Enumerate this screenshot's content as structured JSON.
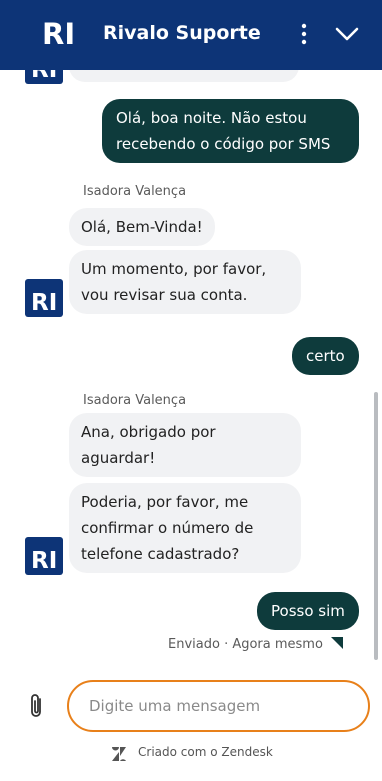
{
  "header": {
    "logo_text": "RI",
    "title": "Rivalo Suporte"
  },
  "messages": {
    "user_1": "Olá, boa noite. Não estou recebendo o código por SMS",
    "sender_1": "Isadora Valença",
    "agent_1": "Olá, Bem-Vinda!",
    "agent_2": "Um momento, por favor, vou revisar sua conta.",
    "user_2": "certo",
    "sender_2": "Isadora Valença",
    "agent_3": "Ana, obrigado por aguardar!",
    "agent_4": "Poderia, por favor, me confirmar o número de telefone cadastrado?",
    "user_3": "Posso sim",
    "status": "Enviado · Agora mesmo"
  },
  "composer": {
    "placeholder": "Digite uma mensagem",
    "value": ""
  },
  "footer": {
    "powered_by": "Criado com o Zendesk"
  },
  "colors": {
    "header_bg": "#0d3477",
    "user_bubble": "#0e3b3c",
    "agent_bubble": "#f1f2f4",
    "input_border": "#e8801a"
  }
}
